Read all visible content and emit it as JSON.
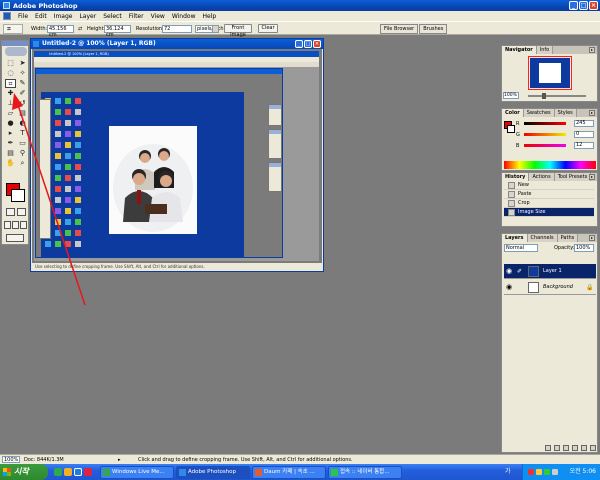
{
  "window": {
    "title": "Adobe Photoshop",
    "min": "_",
    "max": "□",
    "close": "×"
  },
  "menu": [
    "File",
    "Edit",
    "Image",
    "Layer",
    "Select",
    "Filter",
    "View",
    "Window",
    "Help"
  ],
  "options": {
    "width_label": "Width:",
    "width_value": "45.156 cm",
    "height_label": "Height:",
    "height_value": "36.124 cm",
    "resolution_label": "Resolution:",
    "resolution_value": "72",
    "unit_value": "pixels/inch",
    "front_image": "Front Image",
    "clear": "Clear",
    "well_tabs": [
      "File Browser",
      "Brushes"
    ]
  },
  "document": {
    "title": "Untitled-2 @ 100% (Layer 1, RGB)",
    "status": "Use selecting to define cropping frame. Use Shift, Alt, and Ctrl for additional options."
  },
  "inner": {
    "title": "Untitled-2 @ 100% (Layer 1, RGB)"
  },
  "navigator": {
    "tabs": [
      "Navigator",
      "Info"
    ],
    "zoom": "100%"
  },
  "color": {
    "tabs": [
      "Color",
      "Swatches",
      "Styles"
    ],
    "fg": "#e80000",
    "bg": "#ffffff",
    "channels": [
      {
        "label": "R",
        "value": "245"
      },
      {
        "label": "G",
        "value": "0"
      },
      {
        "label": "B",
        "value": "12"
      }
    ]
  },
  "history": {
    "tabs": [
      "History",
      "Actions",
      "Tool Presets"
    ],
    "items": [
      "New",
      "Paste",
      "Crop",
      "Image Size"
    ],
    "selected": 3
  },
  "layers": {
    "tabs": [
      "Layers",
      "Channels",
      "Paths"
    ],
    "blend": "Normal",
    "opacity_label": "Opacity:",
    "opacity": "100%",
    "items": [
      "Layer 1",
      "Background"
    ]
  },
  "status": {
    "zoom": "100%",
    "doc": "Doc: 844K/1.3M",
    "hint": "Click and drag to define cropping frame. Use Shift, Alt, and Ctrl for additional options."
  },
  "taskbar": {
    "start": "시작",
    "items": [
      "Windows Live Me...",
      "Adobe Photoshop",
      "Daum 카페 | 속초 ...",
      "접속 :: 네이버 통합..."
    ],
    "ime": "가",
    "clock": "오전 5:06"
  },
  "colors": {
    "accent": "#0a5fd8",
    "selection": "#0a246a",
    "arrow": "#e8161b"
  }
}
